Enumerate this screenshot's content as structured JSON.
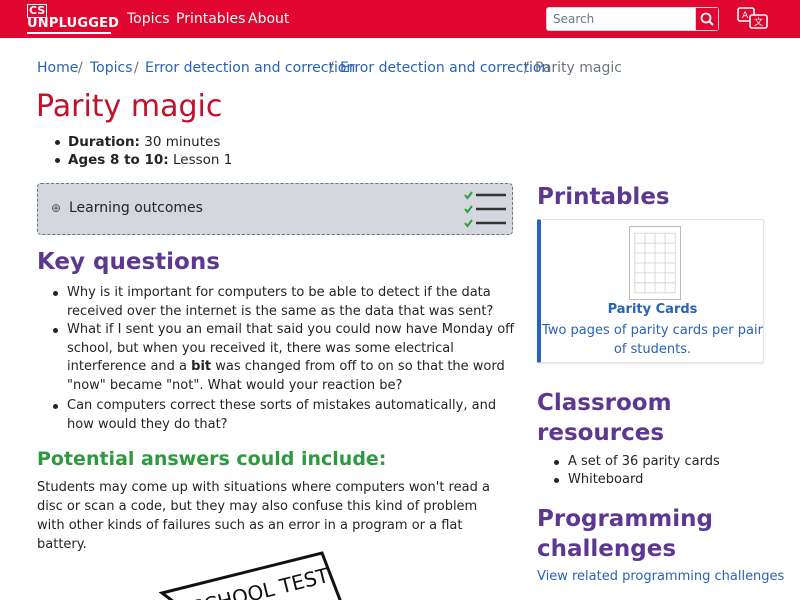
{
  "nav": {
    "logo_top": "CS",
    "logo_bottom": "UNPLUGGED",
    "links": [
      "Topics",
      "Printables",
      "About"
    ],
    "search_placeholder": "Search",
    "icons": [
      "search-icon",
      "language-icon"
    ],
    "brand_color": "#e0062f"
  },
  "breadcrumb": [
    "Home",
    "Topics",
    "Error detection and correction",
    "Error detection and correction",
    "Parity magic"
  ],
  "title": "Parity magic",
  "meta": {
    "duration_label": "Duration:",
    "duration_value": "30 minutes",
    "ages_label": "Ages 8 to 10:",
    "ages_value": "Lesson 1"
  },
  "learning_outcomes": {
    "label": "Learning outcomes",
    "icon": "plus-circle-icon"
  },
  "key_questions": {
    "heading": "Key questions",
    "items": [
      "Why is it important for computers to be able to detect if the data received over the internet is the same as the data that was sent?",
      "What if I sent you an email that said you could now have Monday off school, but when you received it, there was some electrical interference and a",
      "bit",
      "was changed from off to on so that the word \"now\" became \"not\". What would your reaction be?",
      "Can computers correct these sorts of mistakes automatically, and how would they do that?"
    ]
  },
  "answers": {
    "heading": "Potential answers could include:",
    "text": "Students may come up with situations where computers won't read a disc or scan a code, but they may also confuse this kind of problem with other kinds of failures such as an error in a program or a flat battery."
  },
  "image_text": "SCHOOL TEST",
  "printables": {
    "heading": "Printables",
    "card_title": "Parity Cards",
    "card_desc": "Two pages of parity cards per pair of students."
  },
  "classroom": {
    "heading_line1": "Classroom",
    "heading_line2": "resources",
    "items": [
      "A set of 36 parity cards",
      "Whiteboard"
    ]
  },
  "programming": {
    "heading_line1": "Programming",
    "heading_line2": "challenges",
    "link": "View related programming challenges"
  }
}
